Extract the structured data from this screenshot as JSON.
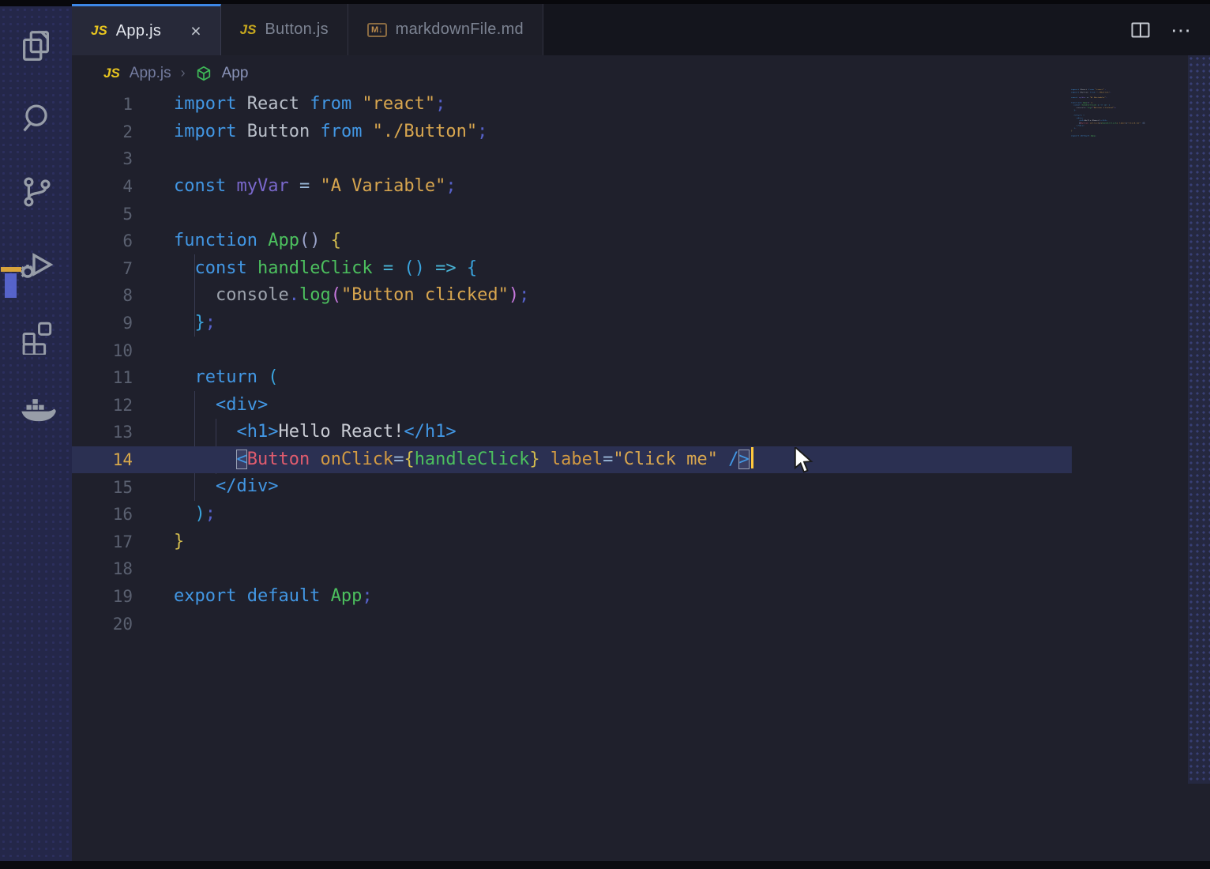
{
  "colors": {
    "accent_blue": "#3d87e6",
    "caret": "#ffc83d",
    "current_line_bg": "#2b3052",
    "overview_marker_gold": "#d8a43c",
    "overview_thumb_blue": "#5f6fe0",
    "syntax": {
      "kw": "#4297e4",
      "id": "#b9bfc9",
      "id2": "#9da3ad",
      "fn": "#4cc05e",
      "vr": "#7a68cc",
      "str": "#d8a64f",
      "pun": "#5661c9",
      "op": "#9ab8d8",
      "cy": "#49b3d6",
      "b1": "#d4bd4e",
      "b2": "#3aa3dc",
      "b3": "#c678dd",
      "tag": "#4297e4",
      "tx": "#c9ccd4",
      "cmp": "#e05c6e",
      "attr": "#d29a43",
      "pn2": "#9aa3c9",
      "pl": "#c9ccd4"
    }
  },
  "activity_bar": {
    "items": [
      {
        "icon": "files-icon"
      },
      {
        "icon": "search-icon"
      },
      {
        "icon": "source-control-icon"
      },
      {
        "icon": "debug-icon"
      },
      {
        "icon": "extensions-icon"
      },
      {
        "icon": "docker-icon"
      }
    ]
  },
  "tab_bar": {
    "tabs": [
      {
        "label": "App.js",
        "badge": "JS",
        "badge_type": "js",
        "active": true,
        "close_label": "×"
      },
      {
        "label": "Button.js",
        "badge": "JS",
        "badge_type": "js",
        "active": false
      },
      {
        "label": "markdownFile.md",
        "badge": "M↓",
        "badge_type": "md",
        "active": false
      }
    ],
    "actions": {
      "more_label": "⋯"
    }
  },
  "breadcrumb": {
    "file_badge": "JS",
    "file": "App.js",
    "separator": "›",
    "symbol": "App"
  },
  "editor": {
    "active_line": 14,
    "line_count": 20,
    "lines": [
      {
        "n": 1,
        "t": [
          [
            "kw",
            "import"
          ],
          [
            "id",
            " React "
          ],
          [
            "kw",
            "from"
          ],
          [
            "str",
            " \"react\""
          ],
          [
            "pun",
            ";"
          ]
        ]
      },
      {
        "n": 2,
        "t": [
          [
            "kw",
            "import"
          ],
          [
            "id",
            " Button "
          ],
          [
            "kw",
            "from"
          ],
          [
            "str",
            " \"./Button\""
          ],
          [
            "pun",
            ";"
          ]
        ]
      },
      {
        "n": 3,
        "t": []
      },
      {
        "n": 4,
        "t": [
          [
            "kw",
            "const"
          ],
          [
            "vr",
            " myVar "
          ],
          [
            "op",
            "= "
          ],
          [
            "str",
            "\"A Variable\""
          ],
          [
            "pun",
            ";"
          ]
        ]
      },
      {
        "n": 5,
        "t": []
      },
      {
        "n": 6,
        "t": [
          [
            "kw",
            "function"
          ],
          [
            "fn",
            " App"
          ],
          [
            "pn2",
            "()"
          ],
          [
            "b1",
            " {"
          ]
        ]
      },
      {
        "n": 7,
        "t": [
          [
            "kw",
            "  const"
          ],
          [
            "fn",
            " handleClick "
          ],
          [
            "cy",
            "="
          ],
          [
            "b2",
            " ()"
          ],
          [
            "cy",
            " =>"
          ],
          [
            "b2",
            " {"
          ]
        ]
      },
      {
        "n": 8,
        "t": [
          [
            "id2",
            "    console"
          ],
          [
            "pun",
            "."
          ],
          [
            "fn",
            "log"
          ],
          [
            "b3",
            "("
          ],
          [
            "str",
            "\"Button clicked\""
          ],
          [
            "b3",
            ")"
          ],
          [
            "pun",
            ";"
          ]
        ]
      },
      {
        "n": 9,
        "t": [
          [
            "b2",
            "  }"
          ],
          [
            "pun",
            ";"
          ]
        ]
      },
      {
        "n": 10,
        "t": []
      },
      {
        "n": 11,
        "t": [
          [
            "kw",
            "  return"
          ],
          [
            "b2",
            " ("
          ]
        ]
      },
      {
        "n": 12,
        "t": [
          [
            "tag",
            "    <div>"
          ]
        ]
      },
      {
        "n": 13,
        "t": [
          [
            "tag",
            "      <h1>"
          ],
          [
            "tx",
            "Hello React!"
          ],
          [
            "tag",
            "</h1>"
          ]
        ]
      },
      {
        "n": 14,
        "t": [
          [
            "pl",
            "      "
          ],
          [
            "tag boxed",
            "<"
          ],
          [
            "cmp",
            "Button"
          ],
          [
            "attr",
            " onClick"
          ],
          [
            "op",
            "="
          ],
          [
            "b1",
            "{"
          ],
          [
            "fn",
            "handleClick"
          ],
          [
            "b1",
            "}"
          ],
          [
            "attr",
            " label"
          ],
          [
            "op",
            "="
          ],
          [
            "str",
            "\"Click me\""
          ],
          [
            "tag",
            " /"
          ],
          [
            "tag boxed",
            ">"
          ],
          [
            "caret",
            ""
          ]
        ]
      },
      {
        "n": 15,
        "t": [
          [
            "tag",
            "    </div>"
          ]
        ]
      },
      {
        "n": 16,
        "t": [
          [
            "b2",
            "  )"
          ],
          [
            "pun",
            ";"
          ]
        ]
      },
      {
        "n": 17,
        "t": [
          [
            "b1",
            "}"
          ]
        ]
      },
      {
        "n": 18,
        "t": []
      },
      {
        "n": 19,
        "t": [
          [
            "kw",
            "export default"
          ],
          [
            "fn",
            " App"
          ],
          [
            "pun",
            ";"
          ]
        ]
      },
      {
        "n": 20,
        "t": []
      }
    ]
  }
}
